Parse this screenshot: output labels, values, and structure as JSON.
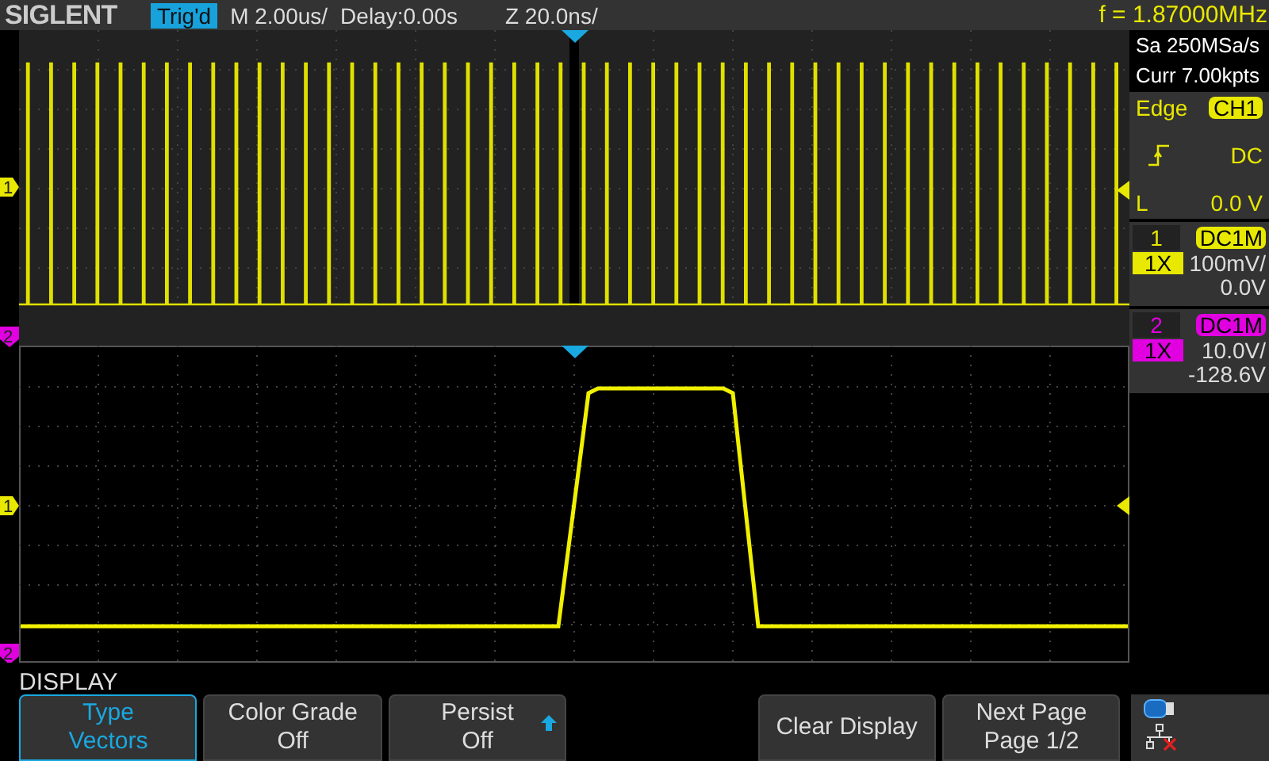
{
  "top_bar": {
    "brand": "SIGLENT",
    "trigger_status": "Trig'd",
    "timebase": "M 2.00us/",
    "delay": "Delay:0.00s",
    "zoom_timebase": "Z 20.0ns/",
    "frequency": "f = 1.87000MHz"
  },
  "left_markers": [
    {
      "label": "1",
      "color": "#e8e800"
    },
    {
      "label": "2",
      "color": "#e000e0"
    },
    {
      "label": "1",
      "color": "#e8e800"
    },
    {
      "label": "2",
      "color": "#e000e0"
    }
  ],
  "acquisition": {
    "sample_rate": "Sa 250MSa/s",
    "memory": "Curr 7.00kpts"
  },
  "trigger": {
    "type": "Edge",
    "source": "CH1",
    "coupling": "DC",
    "level_label": "L",
    "level_value": "0.0 V"
  },
  "channels": [
    {
      "number": "1",
      "coupling": "DC1M",
      "probe": "1X",
      "scale": "100mV/",
      "offset": "0.0V",
      "color": "#e8e800"
    },
    {
      "number": "2",
      "coupling": "DC1M",
      "probe": "1X",
      "scale": "10.0V/",
      "offset": "-128.6V",
      "color": "#e000e0"
    }
  ],
  "menu": {
    "title": "DISPLAY",
    "buttons": [
      {
        "kind": "two_line",
        "top": "Type",
        "bottom": "Vectors",
        "selected": true,
        "arrow": false
      },
      {
        "kind": "two_line",
        "top": "Color Grade",
        "bottom": "Off",
        "selected": false,
        "arrow": false
      },
      {
        "kind": "two_line",
        "top": "Persist",
        "bottom": "Off",
        "selected": false,
        "arrow": true
      },
      {
        "kind": "spacer"
      },
      {
        "kind": "single",
        "label": "Clear Display",
        "selected": false,
        "arrow": false
      },
      {
        "kind": "two_line",
        "top": "Next Page",
        "bottom": "Page 1/2",
        "selected": false,
        "arrow": false
      }
    ]
  }
}
